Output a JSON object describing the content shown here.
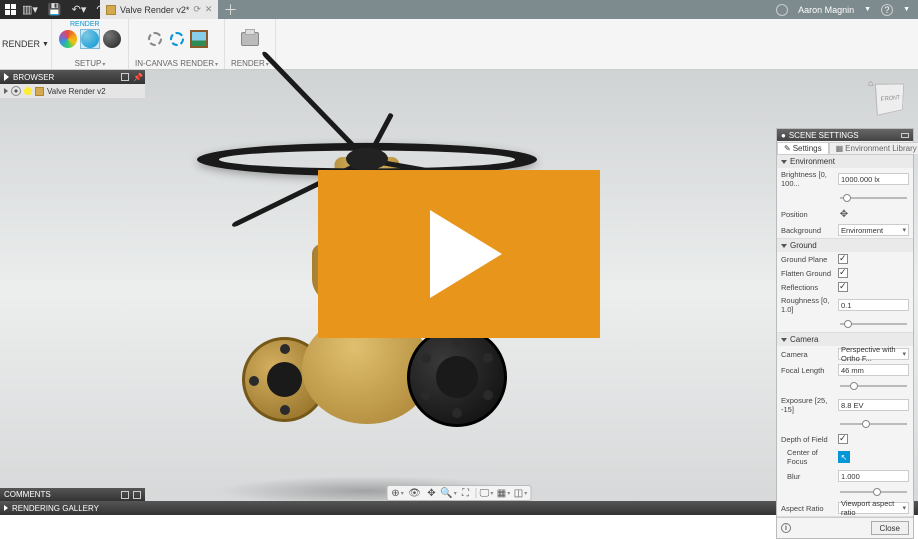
{
  "topbar": {
    "doc_tab": "Valve Render v2*",
    "user": "Aaron Magnin"
  },
  "ribbon": {
    "tab": "RENDER",
    "workspace": "RENDER",
    "panels": {
      "setup": "SETUP",
      "in_canvas": "IN-CANVAS RENDER",
      "render": "RENDER"
    }
  },
  "browser": {
    "title": "BROWSER",
    "root": "Valve Render v2"
  },
  "viewcube": {
    "face": "FRONT"
  },
  "comments": {
    "title": "COMMENTS"
  },
  "gallery": {
    "title": "RENDERING GALLERY"
  },
  "scene": {
    "title": "SCENE SETTINGS",
    "tabs": {
      "settings": "Settings",
      "envlib": "Environment Library"
    },
    "env": {
      "head": "Environment",
      "brightness_label": "Brightness [0, 100...",
      "brightness_value": "1000.000 lx",
      "position_label": "Position",
      "background_label": "Background",
      "background_value": "Environment"
    },
    "ground": {
      "head": "Ground",
      "plane": "Ground Plane",
      "flatten": "Flatten Ground",
      "reflections": "Reflections",
      "roughness_label": "Roughness [0, 1.0]",
      "roughness_value": "0.1"
    },
    "camera": {
      "head": "Camera",
      "camera_label": "Camera",
      "camera_value": "Perspective with Ortho F...",
      "focal_label": "Focal Length",
      "focal_value": "46 mm",
      "exposure_label": "Exposure [25, -15]",
      "exposure_value": "8.8 EV",
      "dof_label": "Depth of Field",
      "cof_label": "Center of Focus",
      "blur_label": "Blur",
      "blur_value": "1.000",
      "aspect_label": "Aspect Ratio",
      "aspect_value": "Viewport aspect ratio"
    },
    "close": "Close"
  }
}
